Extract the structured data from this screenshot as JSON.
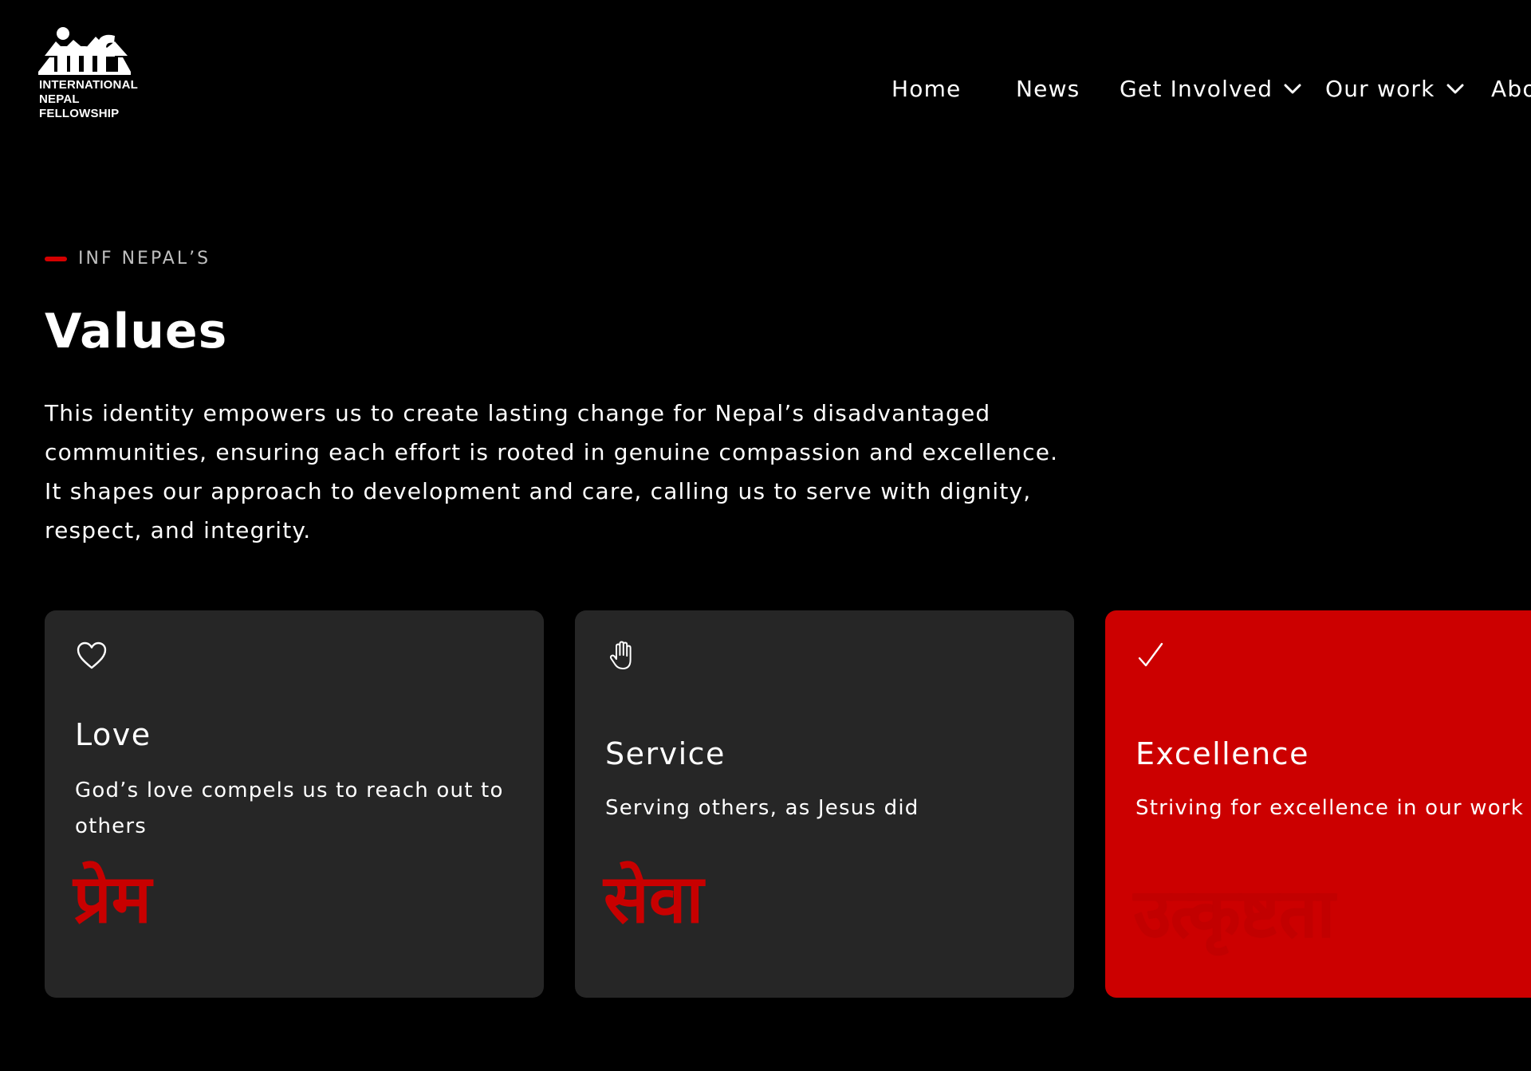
{
  "header": {
    "logo": {
      "mark_text": "inf",
      "lines": [
        "INTERNATIONAL",
        "NEPAL",
        "FELLOWSHIP"
      ]
    },
    "nav": [
      {
        "label": "Home",
        "has_dropdown": false
      },
      {
        "label": "News",
        "has_dropdown": false
      },
      {
        "label": "Get Involved",
        "has_dropdown": true
      },
      {
        "label": "Our work",
        "has_dropdown": true
      },
      {
        "label": "Abo",
        "has_dropdown": false
      }
    ]
  },
  "intro": {
    "eyebrow": "INF NEPAL’S",
    "title": "Values",
    "paragraph": "This identity empowers us to create lasting change for Nepal’s disadvantaged communities, ensuring each effort is rooted in genuine compassion and excellence. It shapes our approach to development and care, calling us to serve with dignity, respect, and integrity."
  },
  "values": [
    {
      "icon": "heart-icon",
      "title": "Love",
      "description": "God’s love compels us to reach out to others",
      "nepali": "प्रेम",
      "highlighted": false
    },
    {
      "icon": "hand-icon",
      "title": "Service",
      "description": "Serving others, as Jesus did",
      "nepali": "सेवा",
      "highlighted": false
    },
    {
      "icon": "checkmark-icon",
      "title": "Excellence",
      "description": "Striving for excellence in our work",
      "nepali": "उत्कृष्टता",
      "highlighted": true
    }
  ],
  "colors": {
    "background": "#000000",
    "card": "#262626",
    "accent": "#cc0000",
    "nepali_text": "#c80000"
  }
}
